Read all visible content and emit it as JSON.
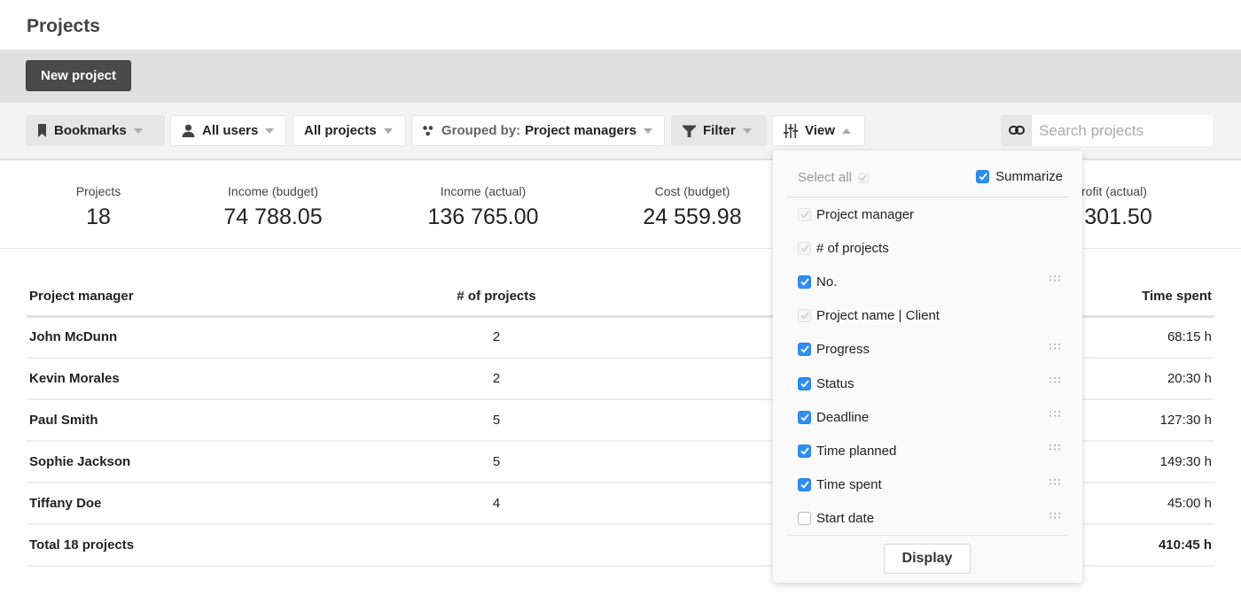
{
  "page": {
    "title": "Projects"
  },
  "actions": {
    "new_project_label": "New project"
  },
  "toolbar": {
    "bookmarks": {
      "label": "Bookmarks",
      "icon": "bookmark-icon"
    },
    "users": {
      "label": "All users",
      "icon": "user-icon"
    },
    "projects": {
      "label": "All projects"
    },
    "grouped": {
      "prefix": "Grouped by:",
      "value": "Project managers",
      "icon": "group-icon"
    },
    "filter": {
      "label": "Filter",
      "icon": "filter-icon"
    },
    "view": {
      "label": "View",
      "icon": "sliders-icon",
      "open": true
    },
    "link_icon": "link-icon",
    "search": {
      "placeholder": "Search projects",
      "value": ""
    }
  },
  "summary": [
    {
      "label": "Projects",
      "value": "18"
    },
    {
      "label": "Income (budget)",
      "value": "74 788.05"
    },
    {
      "label": "Income (actual)",
      "value": "136 765.00"
    },
    {
      "label": "Cost (budget)",
      "value": "24 559.98"
    },
    {
      "label": "rofit (actual)",
      "value": ") 301.50"
    }
  ],
  "table": {
    "columns": [
      "Project manager",
      "# of projects",
      "Time spent"
    ],
    "rows": [
      {
        "manager": "John McDunn",
        "projects": "2",
        "time_spent": "68:15 h"
      },
      {
        "manager": "Kevin Morales",
        "projects": "2",
        "time_spent": "20:30 h"
      },
      {
        "manager": "Paul Smith",
        "projects": "5",
        "time_spent": "127:30 h"
      },
      {
        "manager": "Sophie Jackson",
        "projects": "5",
        "time_spent": "149:30 h"
      },
      {
        "manager": "Tiffany Doe",
        "projects": "4",
        "time_spent": "45:00 h"
      }
    ],
    "total": {
      "label": "Total 18 projects",
      "projects": "",
      "time_spent": "410:45 h"
    }
  },
  "view_popover": {
    "select_all_label": "Select all",
    "summarize_label": "Summarize",
    "summarize_checked": true,
    "columns": [
      {
        "label": "Project manager",
        "state": "locked",
        "draggable": false
      },
      {
        "label": "# of projects",
        "state": "locked",
        "draggable": false
      },
      {
        "label": "No.",
        "state": "checked",
        "draggable": true
      },
      {
        "label": "Project name | Client",
        "state": "locked",
        "draggable": false
      },
      {
        "label": "Progress",
        "state": "checked",
        "draggable": true
      },
      {
        "label": "Status",
        "state": "checked",
        "draggable": true
      },
      {
        "label": "Deadline",
        "state": "checked",
        "draggable": true
      },
      {
        "label": "Time planned",
        "state": "checked",
        "draggable": true
      },
      {
        "label": "Time spent",
        "state": "checked",
        "draggable": true
      },
      {
        "label": "Start date",
        "state": "unchecked",
        "draggable": true
      }
    ],
    "display_label": "Display"
  },
  "colors": {
    "accent": "#2f8ef0",
    "primary_button": "#4a4a4a",
    "action_bar": "#e0e0e0",
    "toolbar": "#f3f3f3"
  }
}
